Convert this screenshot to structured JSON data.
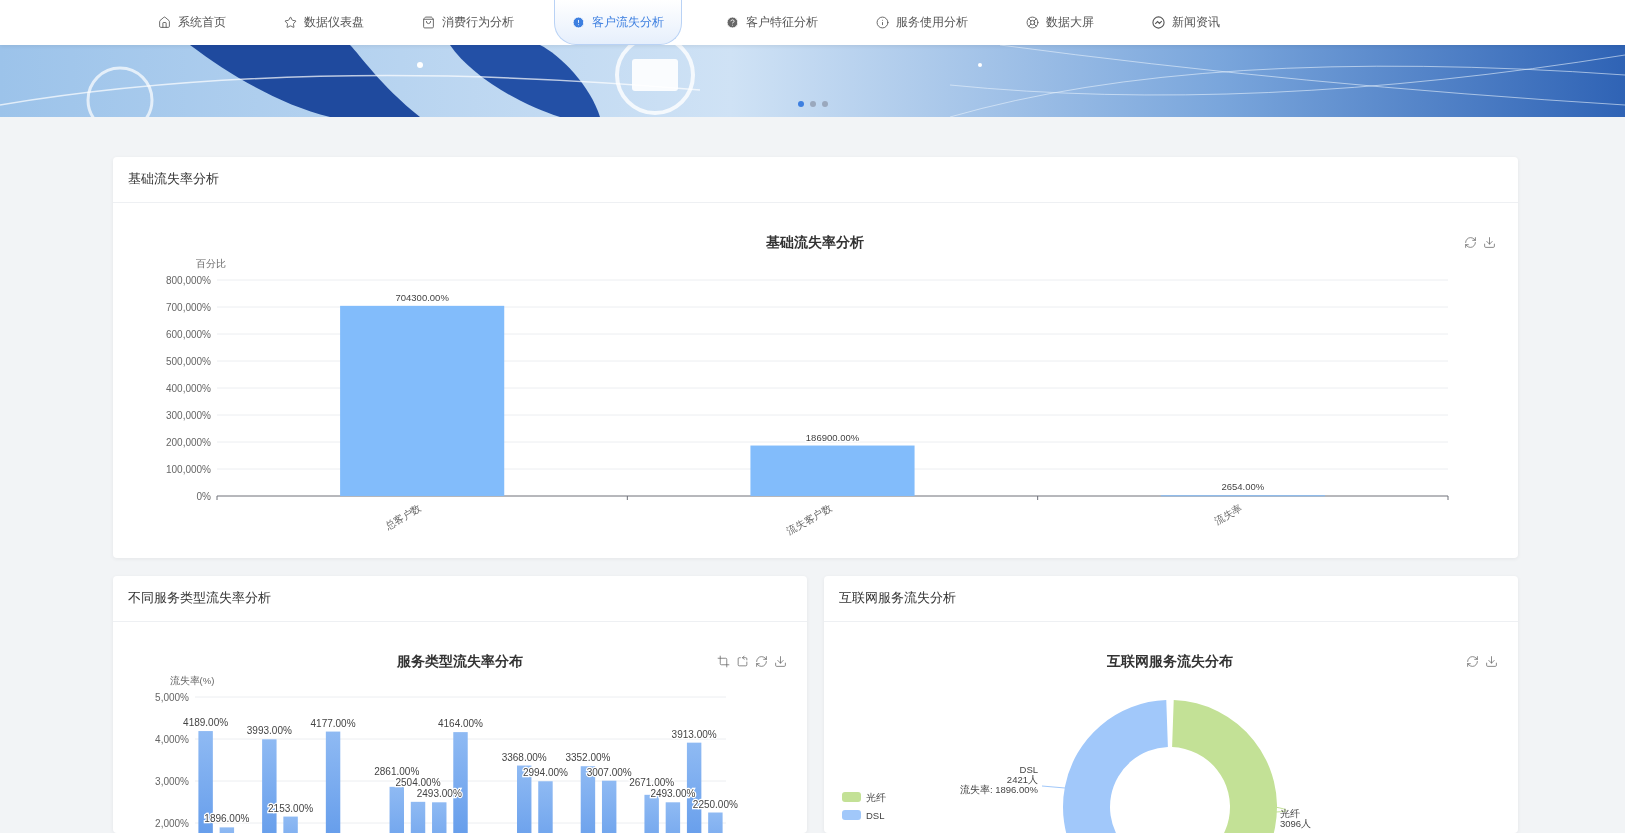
{
  "nav": {
    "items": [
      {
        "label": "系统首页",
        "selected": false
      },
      {
        "label": "数据仪表盘",
        "selected": false
      },
      {
        "label": "消费行为分析",
        "selected": false
      },
      {
        "label": "客户流失分析",
        "selected": true
      },
      {
        "label": "客户特征分析",
        "selected": false
      },
      {
        "label": "服务使用分析",
        "selected": false
      },
      {
        "label": "数据大屏",
        "selected": false
      },
      {
        "label": "新闻资讯",
        "selected": false
      }
    ]
  },
  "banner": {
    "kind": "picture",
    "dots": [
      {
        "selected": true
      },
      {
        "selected": false
      },
      {
        "selected": false
      }
    ]
  },
  "cards": [
    {
      "title": "基础流失率分析",
      "zoom_tools": false,
      "chart_data": {
        "type": "bar",
        "grid": true,
        "title": "基础流失率分析",
        "ylabel": "百分比",
        "categories": [
          "总客户数",
          "流失客户数",
          "流失率"
        ],
        "values": [
          704300,
          186900,
          2654
        ],
        "ylim": [
          0,
          800000
        ],
        "yticks": [
          {
            "value": 0,
            "label": "0%"
          },
          {
            "value": 100000,
            "label": "100,000%"
          },
          {
            "value": 200000,
            "label": "200,000%"
          },
          {
            "value": 300000,
            "label": "300,000%"
          },
          {
            "value": 400000,
            "label": "400,000%"
          },
          {
            "value": 500000,
            "label": "500,000%"
          },
          {
            "value": 600000,
            "label": "600,000%"
          },
          {
            "value": 700000,
            "label": "700,000%"
          },
          {
            "value": 800000,
            "label": "800,000%"
          }
        ],
        "value_labels": [
          "704300.00%",
          "186900.00%",
          "2654.00%"
        ]
      }
    },
    {
      "title": "不同服务类型流失率分析",
      "zoom_tools": true,
      "chart_data": {
        "type": "bar",
        "grid": true,
        "title": "服务类型流失率分布",
        "ylabel": "流失率(%)",
        "values": [
          4189,
          1896,
          null,
          3993,
          2153,
          null,
          4177,
          null,
          null,
          2861,
          2504,
          2493,
          4164,
          null,
          null,
          3368,
          2994,
          null,
          3352,
          3007,
          null,
          2671,
          2493,
          3913,
          2250
        ],
        "ylim": [
          0,
          5000
        ],
        "yticks": [
          {
            "value": 2000,
            "label": "2,000%"
          },
          {
            "value": 3000,
            "label": "3,000%"
          },
          {
            "value": 4000,
            "label": "4,000%"
          },
          {
            "value": 5000,
            "label": "5,000%"
          }
        ],
        "value_labels": [
          "4189.00%",
          "1896.00%",
          null,
          "3993.00%",
          "2153.00%",
          null,
          "4177.00%",
          null,
          null,
          "2861.00%",
          "2504.00%",
          "2493.00%",
          "4164.00%",
          null,
          null,
          "3368.00%",
          "2994.00%",
          null,
          "3352.00%",
          "3007.00%",
          null,
          "2671.00%",
          "2493.00%",
          "3913.00%",
          "2250.00%"
        ]
      }
    },
    {
      "title": "互联网服务流失分析",
      "zoom_tools": false,
      "chart_data": {
        "type": "donut",
        "title": "互联网服务流失分布",
        "categories": [
          "光纤",
          "DSL"
        ],
        "values": [
          3096,
          2421
        ],
        "value_labels": [
          "3096人",
          "2421人"
        ]
      },
      "legend": [
        {
          "label": "光纤",
          "color": "#c3e196"
        },
        {
          "label": "DSL",
          "color": "#a1c8fa"
        }
      ],
      "dsl_rate_label": "流失率: 1896.00%"
    }
  ]
}
